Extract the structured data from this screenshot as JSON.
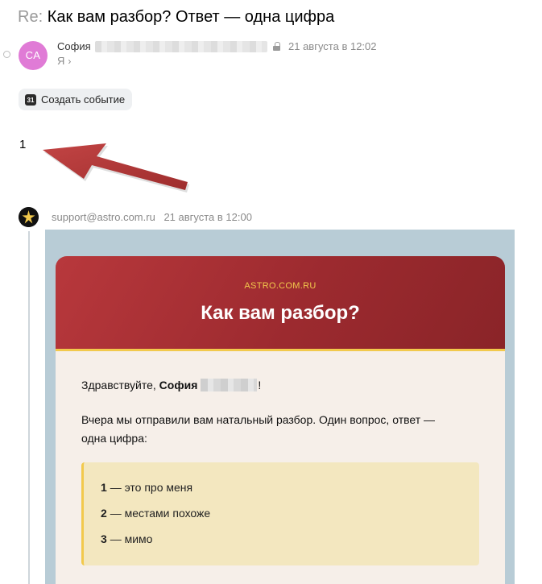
{
  "subject": {
    "prefix": "Re:",
    "title": "Как вам разбор? Ответ — одна цифра"
  },
  "reply": {
    "avatar_initials": "СА",
    "avatar_color": "#e07bd6",
    "sender_name": "София",
    "date": "21 августа в 12:02",
    "recipient": "Я",
    "recipient_chevron": "›",
    "body": "1"
  },
  "actions": {
    "create_event_label": "Создать событие",
    "calendar_icon_text": "31"
  },
  "quoted": {
    "sender_email": "support@astro.com.ru",
    "date": "21 августа в 12:00",
    "brand": "ASTRO.COM.RU",
    "heading": "Как вам разбор?",
    "greeting_prefix": "Здравствуйте,",
    "greeting_name": "София",
    "greeting_suffix": "!",
    "intro": "Вчера мы отправили вам натальный разбор. Один вопрос, ответ — одна цифра:",
    "options": [
      {
        "number": "1",
        "text": "— это про меня"
      },
      {
        "number": "2",
        "text": "— местами похоже"
      },
      {
        "number": "3",
        "text": "— мимо"
      }
    ]
  },
  "colors": {
    "header_red": "#a8313a",
    "accent_gold": "#f2c94c",
    "card_background": "#f6efe9",
    "options_background": "#f3e7bf",
    "quote_frame": "#b8ccd6",
    "annotation_arrow": "#b33a3a"
  },
  "icons": [
    "lock-icon",
    "chevron-right-icon",
    "calendar-icon",
    "astro-logo-icon",
    "annotation-arrow"
  ]
}
